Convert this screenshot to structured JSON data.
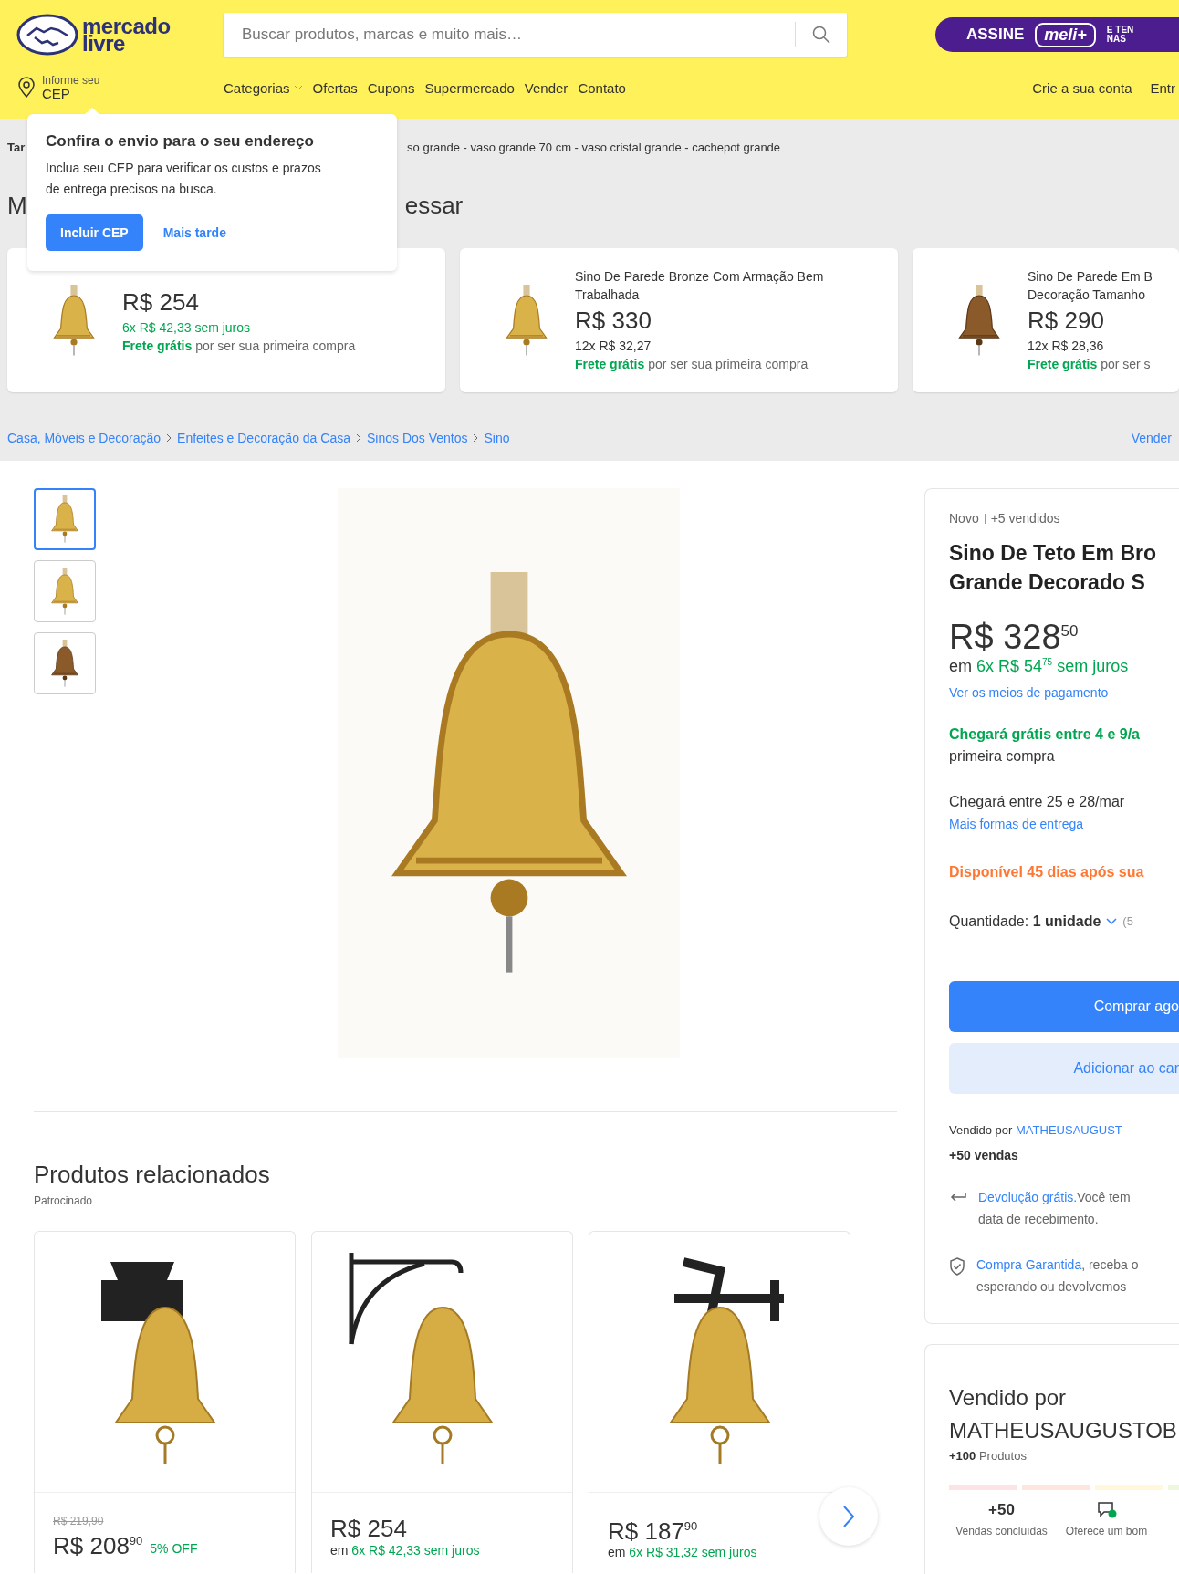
{
  "header": {
    "logo_lines": [
      "mercado",
      "livre"
    ],
    "search": {
      "placeholder": "Buscar produtos, marcas e muito mais…"
    },
    "subscription": {
      "label": "ASSINE",
      "badge": "meli+",
      "tagline": [
        "E TEN",
        "NAS"
      ]
    },
    "location": {
      "label": "Informe seu",
      "value": "CEP"
    },
    "nav": [
      {
        "label": "Categorias",
        "kind": "dropdown"
      },
      {
        "label": "Ofertas",
        "kind": "link"
      },
      {
        "label": "Cupons",
        "kind": "link"
      },
      {
        "label": "Supermercado",
        "kind": "link"
      },
      {
        "label": "Vender",
        "kind": "link"
      },
      {
        "label": "Contato",
        "kind": "link"
      }
    ],
    "account_links": [
      "Crie a sua conta",
      "Entr"
    ]
  },
  "cep_popup": {
    "title": "Confira o envio para o seu endereço",
    "text": "Inclua seu CEP para verificar os custos e prazos de entrega precisos na busca.",
    "primary_button": "Incluir CEP",
    "secondary_link": "Mais tarde"
  },
  "related_searches": {
    "lead": "Tar",
    "text": "so grande - vaso grande 70 cm - vaso cristal grande - cachepot grande"
  },
  "recommendations": {
    "heading_parts": [
      "M",
      "essar"
    ],
    "items": [
      {
        "price": "R$ 254",
        "installments": "6x R$ 42,33 sem juros",
        "interest_free": true,
        "shipping": "**Frete grátis** por ser sua primeira compra"
      },
      {
        "title_lines": [
          "Sino De Parede Bronze Com Armação Bem",
          "Trabalhada"
        ],
        "price": "R$ 330",
        "installments": "12x R$ 32,27",
        "interest_free": false,
        "shipping": "**Frete grátis** por ser sua primeira compra"
      },
      {
        "title_lines": [
          "Sino De Parede Em B",
          "Decoração Tamanho"
        ],
        "price": "R$ 290",
        "installments": "12x R$ 28,36",
        "interest_free": false,
        "shipping": "**Frete grátis** por ser s"
      }
    ]
  },
  "breadcrumb": {
    "items": [
      "Casa, Móveis e Decoração",
      "Enfeites e Decoração da Casa",
      "Sinos Dos Ventos",
      "Sino"
    ],
    "sell_link": "Vender"
  },
  "gallery": {
    "thumbnails": [
      {
        "selected": true
      },
      {
        "selected": false
      },
      {
        "selected": false
      }
    ]
  },
  "product": {
    "condition": "Novo",
    "sold": "+5 vendidos",
    "title_lines": [
      "Sino De Teto Em Bro",
      "Grande Decorado S"
    ],
    "price": "R$ 328$^{50}$",
    "installments_prefix": "em",
    "installments": "6x R$ 54$^{75}$ sem juros",
    "payment_link": "Ver os meios de pagamento",
    "shipping": [
      {
        "kind": "free",
        "text": "Chegará grátis entre 4 e 9/a",
        "rest": "primeira compra"
      },
      {
        "kind": "standard",
        "text": "Chegará entre 25 e 28/mar",
        "link": "Mais formas de entrega"
      }
    ],
    "availability": "Disponível 45 dias após sua",
    "quantity": {
      "text": "Quantidade: **1 unidade**",
      "note": "(5"
    },
    "buttons": [
      {
        "label": "Comprar ago",
        "kind": "primary"
      },
      {
        "label": "Adicionar ao car",
        "kind": "secondary"
      }
    ],
    "seller": {
      "prefix": "Vendido por",
      "name": "MATHEUSAUGUST"
    },
    "sales": "+50 vendas",
    "benefits": [
      {
        "kind": "return",
        "link": "Devolução grátis.",
        "rest": "Você tem",
        "line2": "data de recebimento."
      },
      {
        "kind": "guarantee",
        "link": "Compra Garantida",
        "rest": ", receba o",
        "line2": "esperando ou devolvemos"
      }
    ]
  },
  "seller_card": {
    "heading": "Vendido por",
    "name": "MATHEUSAUGUSTOB",
    "products_count": "+100",
    "products_label": "Produtos",
    "reputation": [
      {
        "color": "#fde3e3"
      },
      {
        "color": "#fee6dd"
      },
      {
        "color": "#fff8d9"
      },
      {
        "color": "#eef8df"
      }
    ],
    "stats": [
      {
        "kind": "value",
        "value": "+50",
        "label": "Vendas concluídas"
      },
      {
        "kind": "icon",
        "label": "Oferece um bom"
      }
    ]
  },
  "related": {
    "heading": "Produtos relacionados",
    "sponsored": "Patrocinado",
    "items": [
      {
        "old_price": "R$ 219,90",
        "price": "R$ 208$^{90}$",
        "discount": "5% OFF"
      },
      {
        "price": "R$ 254",
        "installments_prefix": "em",
        "installments": "6x R$ 42,33 sem juros"
      },
      {
        "price": "R$ 187$^{90}$",
        "installments_prefix": "em",
        "installments": "6x R$ 31,32 sem juros"
      }
    ]
  }
}
